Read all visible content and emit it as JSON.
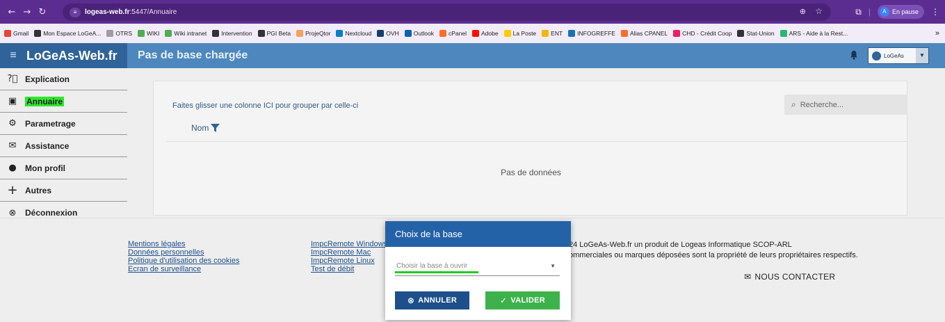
{
  "browser": {
    "url_host": "logeas-web.fr",
    "url_path": ":5447/Annuaire",
    "pause_label": "En pause",
    "profile_initial": "A"
  },
  "bookmarks": [
    {
      "label": "Gmail",
      "color": "#ea4335"
    },
    {
      "label": "Mon Espace LoGeA...",
      "color": "#333333"
    },
    {
      "label": "OTRS",
      "color": "#9e9e9e"
    },
    {
      "label": "WIKI",
      "color": "#4caf50"
    },
    {
      "label": "Wiki intranet",
      "color": "#4caf50"
    },
    {
      "label": "Intervention",
      "color": "#333333"
    },
    {
      "label": "PGI Beta",
      "color": "#333333"
    },
    {
      "label": "ProjeQtor",
      "color": "#f4a261"
    },
    {
      "label": "Nextcloud",
      "color": "#0082c9"
    },
    {
      "label": "OVH",
      "color": "#123f6d"
    },
    {
      "label": "Outlook",
      "color": "#0a64ad"
    },
    {
      "label": "cPanel",
      "color": "#ff6c2c"
    },
    {
      "label": "Adobe",
      "color": "#fa0f00"
    },
    {
      "label": "La Poste",
      "color": "#ffcc00"
    },
    {
      "label": "ENT",
      "color": "#f2b705"
    },
    {
      "label": "INFOGREFFE",
      "color": "#1d70b8"
    },
    {
      "label": "Alias CPANEL",
      "color": "#ff6c2c"
    },
    {
      "label": "CHD - Crédit Coop",
      "color": "#e91e63"
    },
    {
      "label": "Stat-Union",
      "color": "#333333"
    },
    {
      "label": "ARS - Aide à la Rest...",
      "color": "#2bb673"
    }
  ],
  "app": {
    "brand": "LoGeAs-Web.fr",
    "page_title": "Pas de base chargée",
    "user_label": "LoGeAs"
  },
  "sidebar": {
    "items": [
      {
        "label": "Explication",
        "icon": "help-circle-icon"
      },
      {
        "label": "Annuaire",
        "icon": "address-book-icon"
      },
      {
        "label": "Parametrage",
        "icon": "gear-icon"
      },
      {
        "label": "Assistance",
        "icon": "envelope-icon"
      },
      {
        "label": "Mon profil",
        "icon": "user-icon"
      },
      {
        "label": "Autres",
        "icon": "plus-icon"
      },
      {
        "label": "Déconnexion",
        "icon": "close-circle-icon"
      }
    ]
  },
  "grid": {
    "group_hint": "Faites glisser une colonne ICI pour grouper par celle-ci",
    "search_placeholder": "Recherche...",
    "column_name": "Nom",
    "no_data": "Pas de données"
  },
  "footer": {
    "links_col1": [
      "Mentions légales",
      "Données personnelles",
      "Politique d'utilisation des cookies",
      "Ecran de surveillance"
    ],
    "links_col2": [
      "ImpcRemote Windows",
      "ImpcRemote Mac",
      "ImpcRemote Linux",
      "Test de débit"
    ],
    "copyright_line1": "24 LoGeAs-Web.fr un produit de Logeas Informatique SCOP-ARL",
    "copyright_line2": "ommerciales ou marques déposées sont la propriété de leurs propriétaires respectifs.",
    "contact_label": "NOUS CONTACTER"
  },
  "dialog": {
    "title": "Choix de la base",
    "select_placeholder": "Choisir la base à ouvrir",
    "cancel_label": "ANNULER",
    "ok_label": "VALIDER"
  },
  "colors": {
    "browser_chrome": "#5b2d90",
    "app_bar": "#4d87be",
    "brand_bar": "#2f6399",
    "dialog_header": "#2462a8",
    "cancel_button": "#1d4f8a",
    "ok_button": "#3eb24a",
    "highlight": "#2ee62e"
  }
}
